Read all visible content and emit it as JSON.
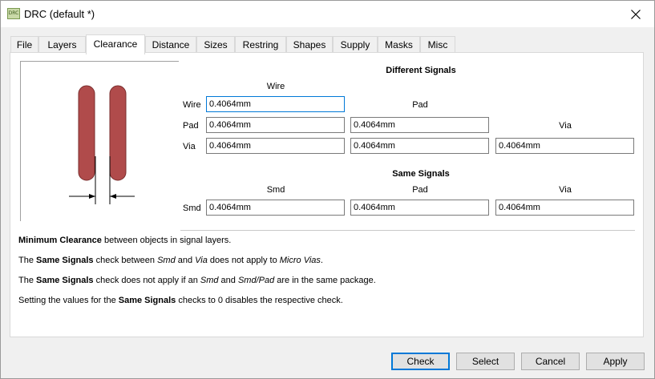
{
  "window": {
    "title": "DRC (default *)",
    "app_icon_text": "DRC"
  },
  "tabs": [
    {
      "label": "File"
    },
    {
      "label": "Layers"
    },
    {
      "label": "Clearance"
    },
    {
      "label": "Distance"
    },
    {
      "label": "Sizes"
    },
    {
      "label": "Restring"
    },
    {
      "label": "Shapes"
    },
    {
      "label": "Supply"
    },
    {
      "label": "Masks"
    },
    {
      "label": "Misc"
    }
  ],
  "active_tab": "Clearance",
  "different_signals": {
    "heading": "Different Signals",
    "col_wire": "Wire",
    "col_pad": "Pad",
    "col_via": "Via",
    "row_wire": "Wire",
    "row_pad": "Pad",
    "row_via": "Via",
    "wire_wire": "0.4064mm",
    "pad_wire": "0.4064mm",
    "pad_pad": "0.4064mm",
    "via_wire": "0.4064mm",
    "via_pad": "0.4064mm",
    "via_via": "0.4064mm"
  },
  "same_signals": {
    "heading": "Same Signals",
    "col_smd": "Smd",
    "col_pad": "Pad",
    "col_via": "Via",
    "row_smd": "Smd",
    "smd_smd": "0.4064mm",
    "smd_pad": "0.4064mm",
    "smd_via": "0.4064mm"
  },
  "notes": {
    "n1_bold": "Minimum Clearance",
    "n1_rest": " between objects in signal layers.",
    "n2_a": "The ",
    "n2_bold": "Same Signals",
    "n2_b": " check between ",
    "n2_i1": "Smd",
    "n2_c": " and ",
    "n2_i2": "Via",
    "n2_d": " does not apply to ",
    "n2_i3": "Micro Vias",
    "n2_e": ".",
    "n3_a": "The ",
    "n3_bold": "Same Signals",
    "n3_b": " check does not apply if an ",
    "n3_i1": "Smd",
    "n3_c": " and ",
    "n3_i2": "Smd/Pad",
    "n3_d": " are in the same package.",
    "n4_a": "Setting the values for the ",
    "n4_bold": "Same Signals",
    "n4_b": " checks to 0 disables the respective check."
  },
  "buttons": {
    "check": "Check",
    "select": "Select",
    "cancel": "Cancel",
    "apply": "Apply"
  },
  "colors": {
    "wire_fill": "#b04b4b",
    "focus_border": "#0078d7"
  },
  "icons": {
    "close": "close-icon"
  }
}
